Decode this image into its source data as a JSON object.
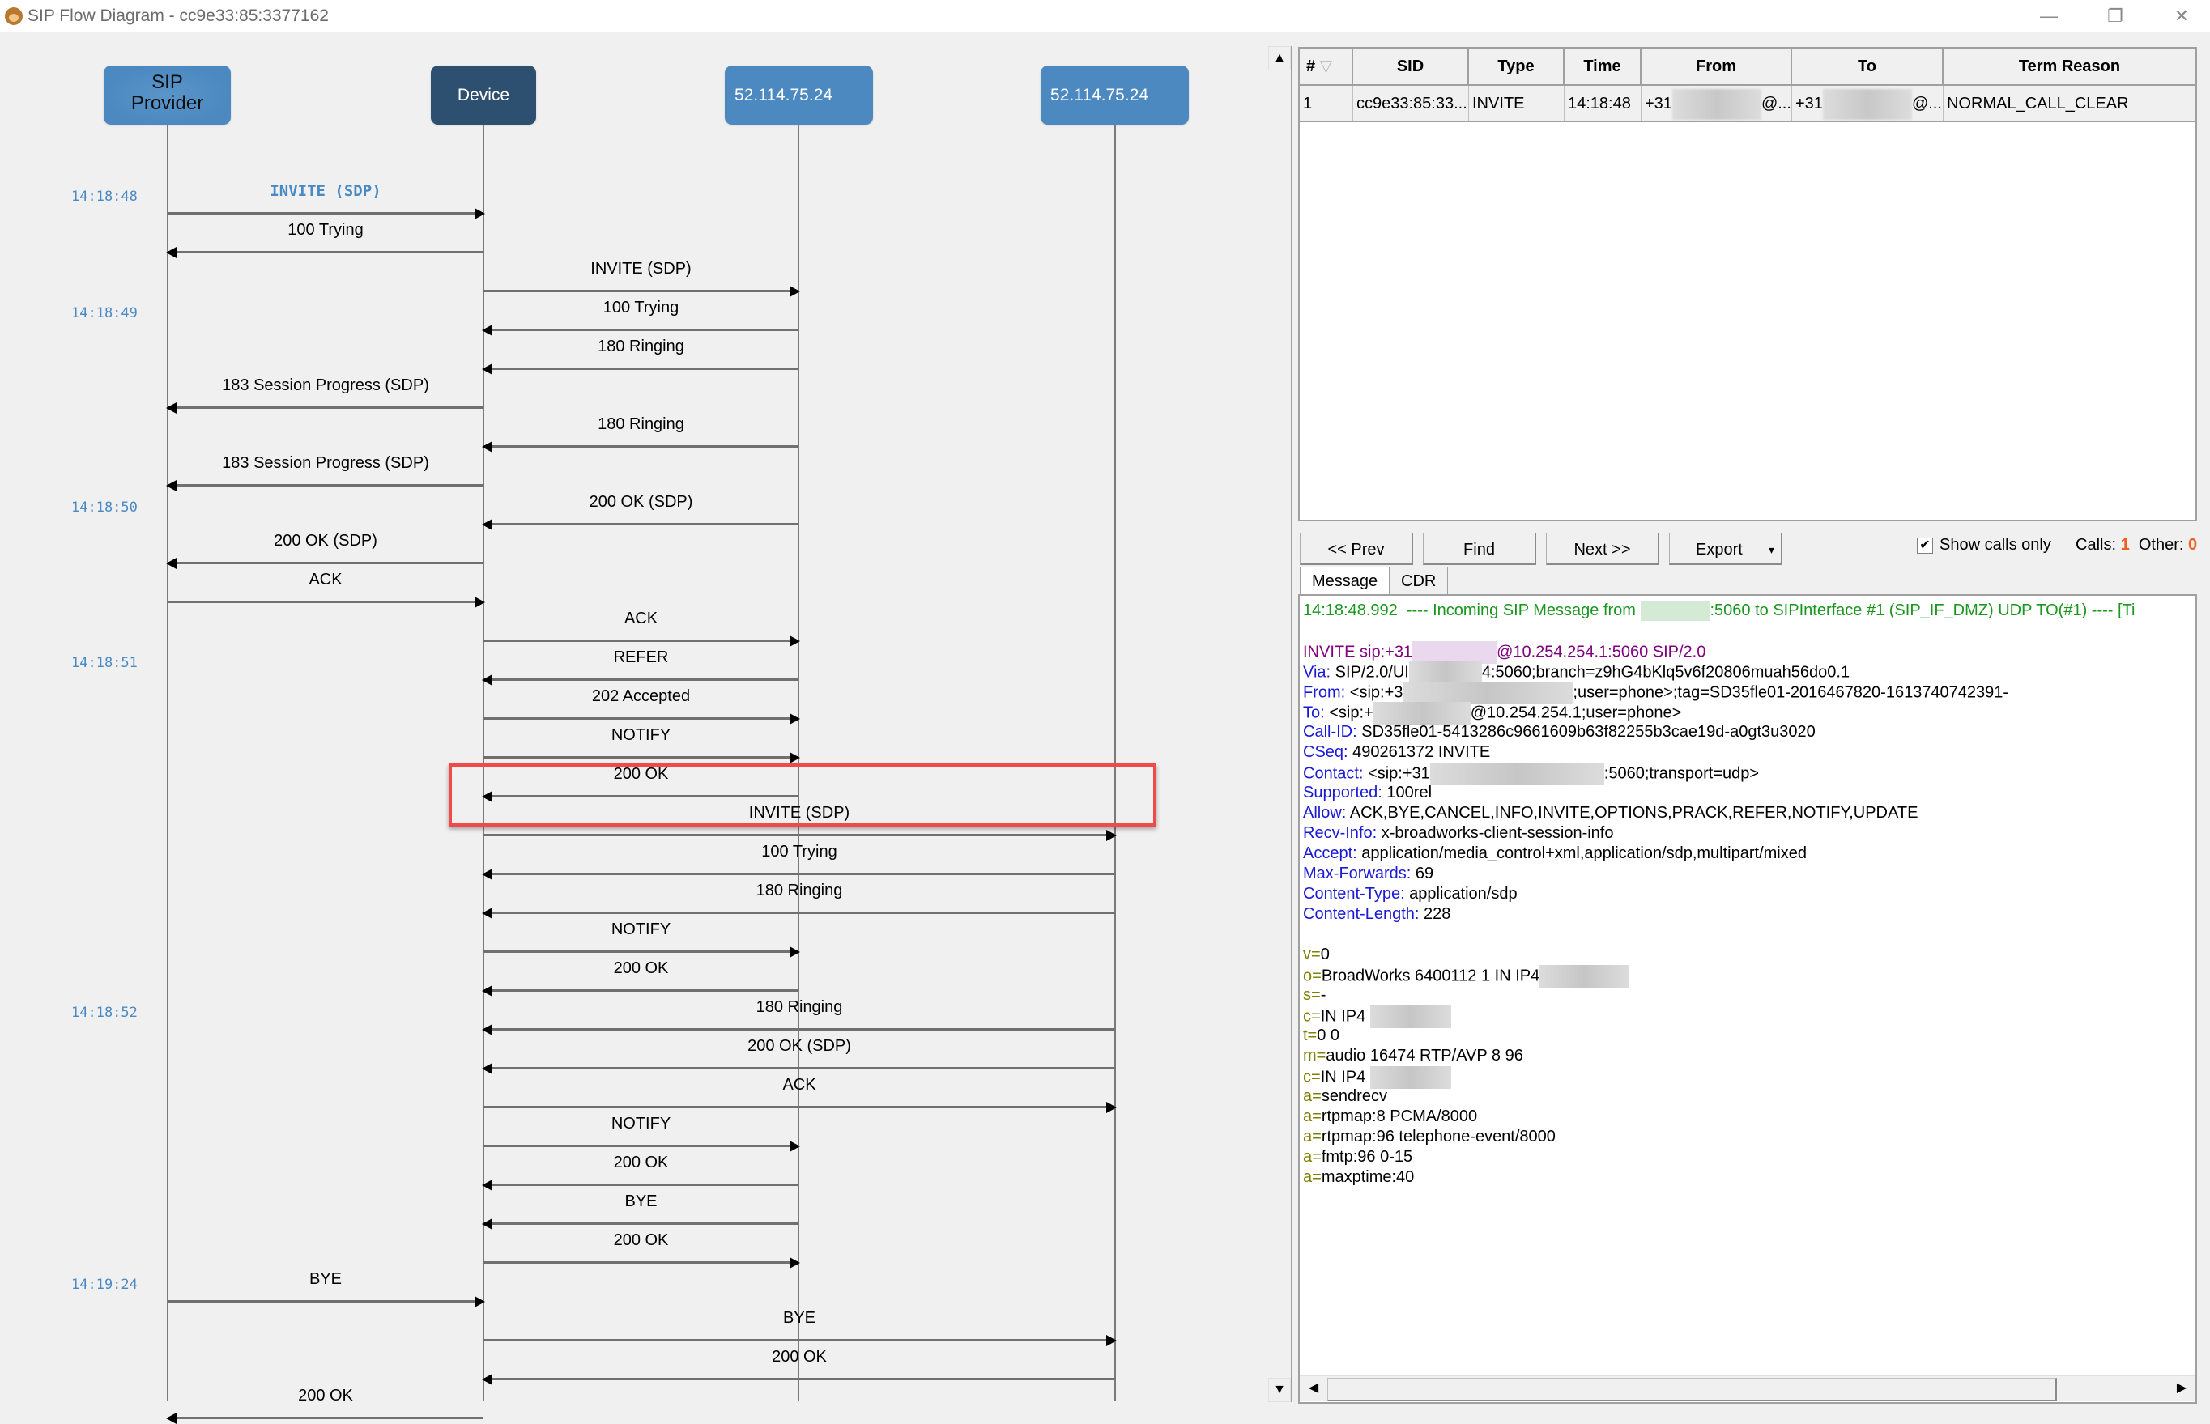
{
  "window": {
    "title": "SIP Flow Diagram - cc9e33:85:3377162",
    "icon": "monkey-icon",
    "controls": {
      "minimize": "—",
      "restore": "❐",
      "close": "✕"
    }
  },
  "diagram": {
    "participants": [
      {
        "label": "SIP\nProvider",
        "line1": "SIP",
        "line2": "Provider",
        "style": "light-blue"
      },
      {
        "label": "Device",
        "style": "dark-blue"
      },
      {
        "label": "52.114.75.24",
        "style": "blue"
      },
      {
        "label": "52.114.75.24",
        "style": "blue"
      }
    ],
    "timestamps": [
      {
        "text": "14:18:48",
        "row": 0
      },
      {
        "text": "14:18:49",
        "row": 3
      },
      {
        "text": "14:18:50",
        "row": 8
      },
      {
        "text": "14:18:51",
        "row": 12
      },
      {
        "text": "14:18:52",
        "row": 21
      },
      {
        "text": "14:19:24",
        "row": 28
      }
    ],
    "messages": [
      {
        "label": "INVITE (SDP)",
        "from": 0,
        "to": 1,
        "selected": true
      },
      {
        "label": "100 Trying",
        "from": 1,
        "to": 0
      },
      {
        "label": "INVITE (SDP)",
        "from": 1,
        "to": 2
      },
      {
        "label": "100 Trying",
        "from": 2,
        "to": 1
      },
      {
        "label": "180 Ringing",
        "from": 2,
        "to": 1
      },
      {
        "label": "183 Session Progress (SDP)",
        "from": 1,
        "to": 0
      },
      {
        "label": "180 Ringing",
        "from": 2,
        "to": 1
      },
      {
        "label": "183 Session Progress (SDP)",
        "from": 1,
        "to": 0
      },
      {
        "label": "200 OK (SDP)",
        "from": 2,
        "to": 1
      },
      {
        "label": "200 OK (SDP)",
        "from": 1,
        "to": 0
      },
      {
        "label": "ACK",
        "from": 0,
        "to": 1
      },
      {
        "label": "ACK",
        "from": 1,
        "to": 2
      },
      {
        "label": "REFER",
        "from": 2,
        "to": 1
      },
      {
        "label": "202 Accepted",
        "from": 1,
        "to": 2
      },
      {
        "label": "NOTIFY",
        "from": 1,
        "to": 2
      },
      {
        "label": "200 OK",
        "from": 2,
        "to": 1
      },
      {
        "label": "INVITE (SDP)",
        "from": 1,
        "to": 3,
        "highlighted": true
      },
      {
        "label": "100 Trying",
        "from": 3,
        "to": 1
      },
      {
        "label": "180 Ringing",
        "from": 3,
        "to": 1
      },
      {
        "label": "NOTIFY",
        "from": 1,
        "to": 2
      },
      {
        "label": "200 OK",
        "from": 2,
        "to": 1
      },
      {
        "label": "180 Ringing",
        "from": 3,
        "to": 1
      },
      {
        "label": "200 OK (SDP)",
        "from": 3,
        "to": 1
      },
      {
        "label": "ACK",
        "from": 1,
        "to": 3
      },
      {
        "label": "NOTIFY",
        "from": 1,
        "to": 2
      },
      {
        "label": "200 OK",
        "from": 2,
        "to": 1
      },
      {
        "label": "BYE",
        "from": 2,
        "to": 1
      },
      {
        "label": "200 OK",
        "from": 1,
        "to": 2
      },
      {
        "label": "BYE",
        "from": 0,
        "to": 1
      },
      {
        "label": "BYE",
        "from": 1,
        "to": 3
      },
      {
        "label": "200 OK",
        "from": 3,
        "to": 1
      },
      {
        "label": "200 OK",
        "from": 1,
        "to": 0
      }
    ],
    "highlight_color": "#f04a4a"
  },
  "calls_table": {
    "columns": [
      "#",
      "SID",
      "Type",
      "Time",
      "From",
      "To",
      "Term Reason"
    ],
    "rows": [
      {
        "num": "1",
        "sid": "cc9e33:85:33...",
        "type": "INVITE",
        "time": "14:18:48",
        "from_prefix": "+31",
        "from_suffix": "@...",
        "to_prefix": "+31",
        "to_suffix": "@...",
        "term_reason": "NORMAL_CALL_CLEAR"
      }
    ]
  },
  "toolbar": {
    "prev": "<< Prev",
    "find": "Find",
    "next": "Next >>",
    "export": "Export",
    "export_arrow": "▾",
    "show_calls_only_label": "Show calls only",
    "show_calls_only_checked": true,
    "calls_label": "Calls:",
    "calls_value": "1",
    "other_label": "Other:",
    "other_value": "0"
  },
  "tabs": [
    {
      "label": "Message",
      "active": true
    },
    {
      "label": "CDR",
      "active": false
    }
  ],
  "message": {
    "header_line": {
      "time": "14:18:48.992",
      "pre": "  ---- Incoming SIP Message from ",
      "post": ":5060 to SIPInterface #1 (SIP_IF_DMZ) UDP TO(#1) ---- [Ti"
    },
    "request_line": {
      "pre": "INVITE sip:+31",
      "post": "@10.254.254.1:5060 SIP/2.0"
    },
    "headers": [
      {
        "name": "Via:",
        "value_pre": " SIP/2.0/UI",
        "value_post": "4:5060;branch=z9hG4bKlq5v6f20806muah56do0.1",
        "blur": 90
      },
      {
        "name": "From:",
        "value_pre": " <sip:+3",
        "value_post": ";user=phone>;tag=SD35fle01-2016467820-1613740742391-",
        "blur": 210
      },
      {
        "name": "To:",
        "value_pre": " <sip:+",
        "value_post": "@10.254.254.1;user=phone>",
        "blur": 120
      },
      {
        "name": "Call-ID:",
        "value_pre": " SD35fle01-5413286c9661609b63f82255b3cae19d-a0gt3u3020",
        "value_post": "",
        "blur": 0
      },
      {
        "name": "CSeq:",
        "value_pre": " 490261372 INVITE",
        "value_post": "",
        "blur": 0
      },
      {
        "name": "Contact:",
        "value_pre": " <sip:+31",
        "value_post": ":5060;transport=udp>",
        "blur": 215
      },
      {
        "name": "Supported:",
        "value_pre": " 100rel",
        "value_post": "",
        "blur": 0
      },
      {
        "name": "Allow:",
        "value_pre": " ACK,BYE,CANCEL,INFO,INVITE,OPTIONS,PRACK,REFER,NOTIFY,UPDATE",
        "value_post": "",
        "blur": 0
      },
      {
        "name": "Recv-Info:",
        "value_pre": " x-broadworks-client-session-info",
        "value_post": "",
        "blur": 0
      },
      {
        "name": "Accept:",
        "value_pre": " application/media_control+xml,application/sdp,multipart/mixed",
        "value_post": "",
        "blur": 0
      },
      {
        "name": "Max-Forwards:",
        "value_pre": " 69",
        "value_post": "",
        "blur": 0
      },
      {
        "name": "Content-Type:",
        "value_pre": " application/sdp",
        "value_post": "",
        "blur": 0
      },
      {
        "name": "Content-Length:",
        "value_pre": " 228",
        "value_post": "",
        "blur": 0
      }
    ],
    "sdp": [
      {
        "key": "v=",
        "value": "0",
        "blur": 0
      },
      {
        "key": "o=",
        "value": "BroadWorks 6400112 1 IN IP4",
        "blur": 110
      },
      {
        "key": "s=",
        "value": "-",
        "blur": 0
      },
      {
        "key": "c=",
        "value": "IN IP4 ",
        "blur": 100
      },
      {
        "key": "t=",
        "value": "0 0",
        "blur": 0
      },
      {
        "key": "m=",
        "value": "audio 16474 RTP/AVP 8 96",
        "blur": 0
      },
      {
        "key": "c=",
        "value": "IN IP4 ",
        "blur": 100
      },
      {
        "key": "a=",
        "value": "sendrecv",
        "blur": 0
      },
      {
        "key": "a=",
        "value": "rtpmap:8 PCMA/8000",
        "blur": 0
      },
      {
        "key": "a=",
        "value": "rtpmap:96 telephone-event/8000",
        "blur": 0
      },
      {
        "key": "a=",
        "value": "fmtp:96 0-15",
        "blur": 0
      },
      {
        "key": "a=",
        "value": "maxptime:40",
        "blur": 0
      }
    ]
  }
}
